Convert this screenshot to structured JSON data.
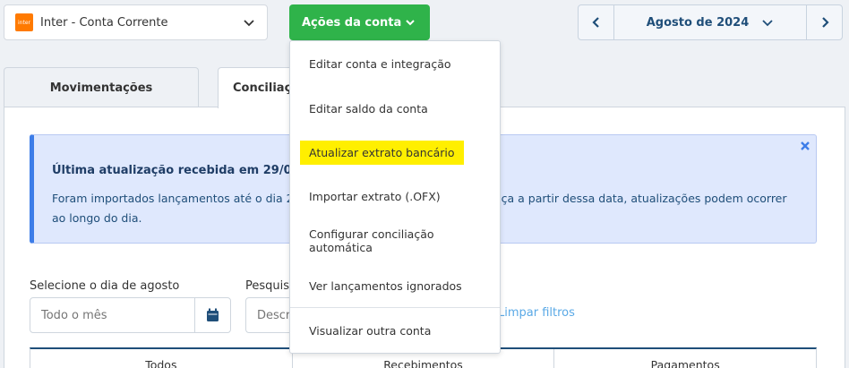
{
  "account": {
    "bank_logo": "inter",
    "name": "Inter - Conta Corrente"
  },
  "actions": {
    "label": "Ações da conta",
    "items": [
      "Editar conta e integração",
      "Editar saldo da conta",
      "Atualizar extrato bancário",
      "Importar extrato (.OFX)",
      "Configurar conciliação automática",
      "Ver lançamentos ignorados",
      "Visualizar outra conta"
    ],
    "highlighted_index": 2
  },
  "month": {
    "label": "Agosto de 2024"
  },
  "tabs": [
    {
      "label": "Movimentações"
    },
    {
      "label": "Conciliação"
    }
  ],
  "alert": {
    "title": "Última atualização recebida em 29/08/2024",
    "text": "Foram importados lançamentos até o dia 28/08/2024. Caso haja alguma diferença a partir dessa data, atualizações podem ocorrer ao longo do dia."
  },
  "filters": {
    "day_label": "Selecione o dia de agosto",
    "day_placeholder": "Todo o mês",
    "search_label": "Pesquisar",
    "search_placeholder": "Descrição",
    "clear_label": "Limpar filtros"
  },
  "segments": [
    "Todos",
    "Recebimentos",
    "Pagamentos"
  ],
  "colors": {
    "accent_green": "#2fb34a",
    "info_blue": "#3d7de8",
    "highlight": "#ffef00",
    "navy": "#1f4e79"
  }
}
